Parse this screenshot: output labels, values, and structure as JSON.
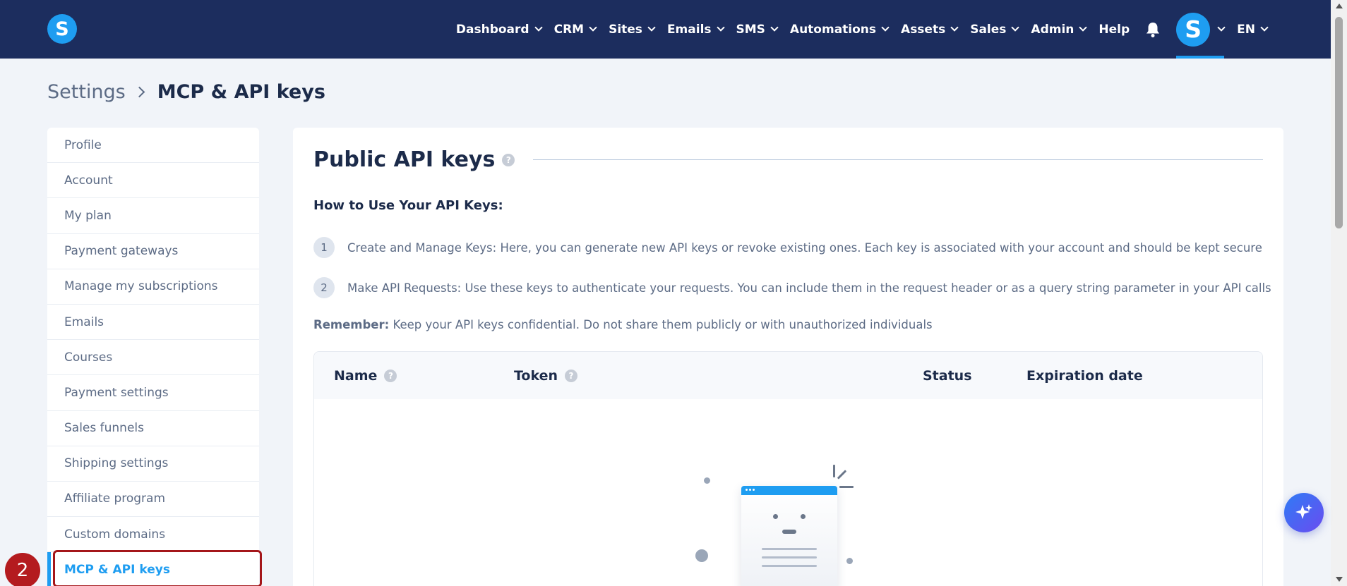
{
  "app": {
    "logo_letter": "S"
  },
  "nav": {
    "items": [
      {
        "label": "Dashboard",
        "has_dropdown": true
      },
      {
        "label": "CRM",
        "has_dropdown": true
      },
      {
        "label": "Sites",
        "has_dropdown": true
      },
      {
        "label": "Emails",
        "has_dropdown": true
      },
      {
        "label": "SMS",
        "has_dropdown": true
      },
      {
        "label": "Automations",
        "has_dropdown": true
      },
      {
        "label": "Assets",
        "has_dropdown": true
      },
      {
        "label": "Sales",
        "has_dropdown": true
      },
      {
        "label": "Admin",
        "has_dropdown": true
      },
      {
        "label": "Help",
        "has_dropdown": false
      }
    ],
    "bell_icon": "bell-icon",
    "avatar_letter": "S",
    "language": "EN"
  },
  "breadcrumb": {
    "parent": "Settings",
    "current": "MCP & API keys"
  },
  "sidebar": {
    "items": [
      {
        "label": "Profile"
      },
      {
        "label": "Account"
      },
      {
        "label": "My plan"
      },
      {
        "label": "Payment gateways"
      },
      {
        "label": "Manage my subscriptions"
      },
      {
        "label": "Emails"
      },
      {
        "label": "Courses"
      },
      {
        "label": "Payment settings"
      },
      {
        "label": "Sales funnels"
      },
      {
        "label": "Shipping settings"
      },
      {
        "label": "Affiliate program"
      },
      {
        "label": "Custom domains"
      },
      {
        "label": "MCP & API keys",
        "active": true
      }
    ]
  },
  "annotation": {
    "step_badge": "2"
  },
  "panel": {
    "title": "Public API keys",
    "help_glyph": "?",
    "howto_heading": "How to Use Your API Keys:",
    "steps": [
      {
        "num": "1",
        "text": "Create and Manage Keys: Here, you can generate new API keys or revoke existing ones. Each key is associated with your account and should be kept secure"
      },
      {
        "num": "2",
        "text": "Make API Requests: Use these keys to authenticate your requests. You can include them in the request header or as a query string parameter in your API calls"
      }
    ],
    "remember_label": "Remember:",
    "remember_text": " Keep your API keys confidential. Do not share them publicly or with unauthorized individuals",
    "table": {
      "columns": [
        {
          "label": "Name",
          "help": true
        },
        {
          "label": "Token",
          "help": true
        },
        {
          "label": "Status",
          "help": false
        },
        {
          "label": "Expiration date",
          "help": false
        }
      ]
    }
  },
  "colors": {
    "nav_bg": "#1c2d5e",
    "accent": "#1e9df1",
    "annotation_red": "#b41b1f"
  },
  "fab_icon": "sparkle-icon"
}
